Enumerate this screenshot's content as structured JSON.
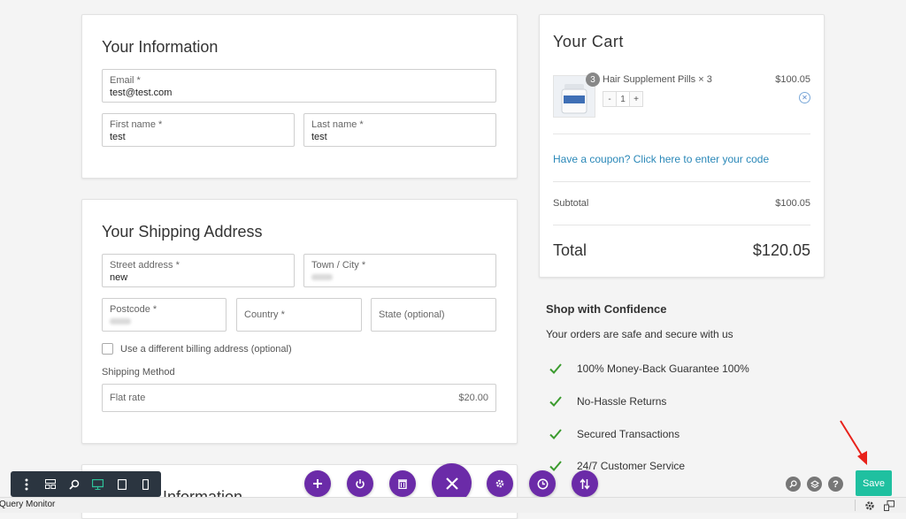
{
  "info": {
    "title": "Your Information",
    "email_label": "Email *",
    "email_value": "test@test.com",
    "first_label": "First name *",
    "first_value": "test",
    "last_label": "Last name *",
    "last_value": "test"
  },
  "shipping": {
    "title": "Your Shipping Address",
    "street_label": "Street address *",
    "street_value": "new",
    "town_label": "Town / City *",
    "postcode_label": "Postcode *",
    "country_label": "Country *",
    "state_label": "State (optional)",
    "billing_checkbox_label": "Use a different billing address (optional)",
    "method_label": "Shipping Method",
    "method_name": "Flat rate",
    "method_price": "$20.00"
  },
  "payment": {
    "title_partial": "...yment Information"
  },
  "cart": {
    "title": "Your Cart",
    "item_badge": "3",
    "item_name": "Hair Supplement Pills × 3",
    "item_price": "$100.05",
    "qty_minus": "-",
    "qty_value": "1",
    "qty_plus": "+",
    "coupon_link": "Have a coupon? Click here to enter your code",
    "subtotal_label": "Subtotal",
    "subtotal_value": "$100.05",
    "total_label": "Total",
    "total_value": "$120.05"
  },
  "confidence": {
    "title": "Shop with Confidence",
    "subtitle": "Your orders are safe and secure with us",
    "items": [
      "100% Money-Back Guarantee 100%",
      "No-Hassle Returns",
      "Secured Transactions",
      "24/7 Customer Service"
    ]
  },
  "bottom": {
    "save_label": "Save",
    "status_left": "Query Monitor",
    "help_label": "?"
  },
  "colors": {
    "accent_purple": "#6b2ba8",
    "save_green": "#1fc0a0",
    "link_blue": "#2a88b8",
    "check_green": "#3b9b2e",
    "annotation_red": "#e8221b"
  }
}
